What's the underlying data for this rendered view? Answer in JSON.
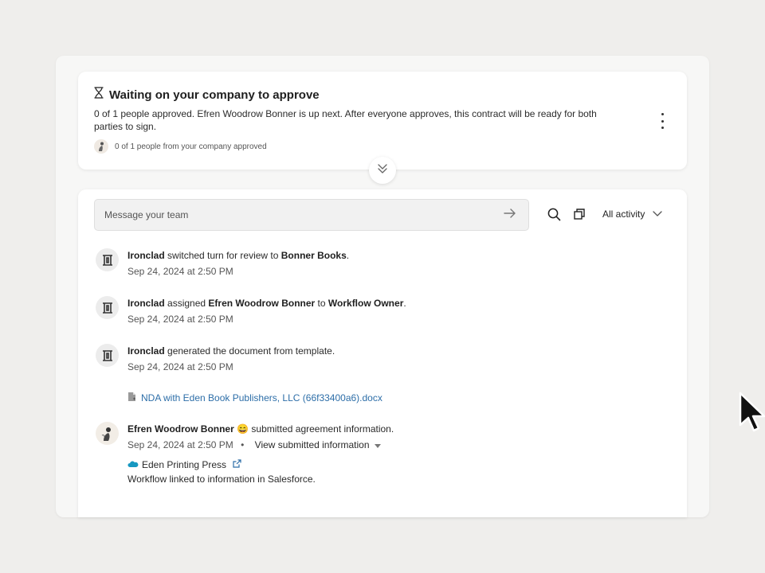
{
  "status": {
    "title": "Waiting on your company to approve",
    "description": "0 of 1 people approved. Efren Woodrow Bonner is up next. After everyone approves, this contract will be ready for both parties to sign.",
    "footer": "0 of 1 people from your company approved"
  },
  "composer": {
    "placeholder": "Message your team"
  },
  "toolbar": {
    "filter_label": "All activity"
  },
  "feed": [
    {
      "actor": "Ironclad",
      "action": "switched turn for review to",
      "target": "Bonner Books",
      "suffix": ".",
      "time": "Sep 24, 2024 at 2:50 PM"
    },
    {
      "actor": "Ironclad",
      "action": "assigned",
      "target": "Efren Woodrow Bonner",
      "middle": "to",
      "target2": "Workflow Owner",
      "suffix": ".",
      "time": "Sep 24, 2024 at 2:50 PM"
    },
    {
      "actor": "Ironclad",
      "action": "generated the document from template.",
      "time": "Sep 24, 2024 at 2:50 PM",
      "document": "NDA with Eden Book Publishers, LLC (66f33400a6).docx"
    },
    {
      "actor": "Efren Woodrow Bonner",
      "emoji": "😄",
      "action": "submitted agreement information.",
      "time": "Sep 24, 2024 at 2:50 PM",
      "separator": "•",
      "view_label": "View submitted information",
      "linked_record": "Eden Printing Press",
      "linked_note": "Workflow linked to information in Salesforce."
    }
  ],
  "colors": {
    "link": "#2d6ea8",
    "salesforce": "#1798c1",
    "background": "#efeeec"
  },
  "icons": [
    "hourglass-icon",
    "kebab-menu-icon",
    "chevron-double-down-icon",
    "arrow-right-icon",
    "search-icon",
    "copy-icon",
    "chevron-down-icon",
    "ironclad-logo-icon",
    "document-icon",
    "salesforce-cloud-icon",
    "external-link-icon",
    "caret-down-icon",
    "mouse-cursor-icon"
  ]
}
